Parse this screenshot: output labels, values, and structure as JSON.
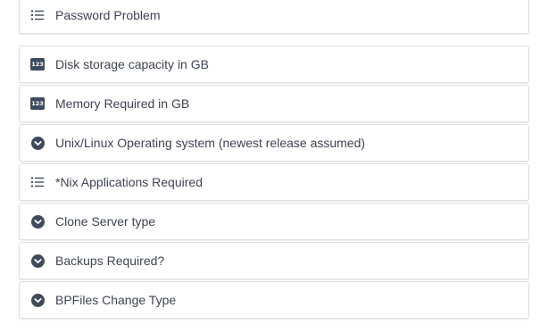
{
  "fields": [
    {
      "icon": "list-icon",
      "label": "Password Problem"
    },
    {
      "icon": "number-icon",
      "label": "Disk storage capacity in GB",
      "badge": "123"
    },
    {
      "icon": "number-icon",
      "label": "Memory Required in GB",
      "badge": "123"
    },
    {
      "icon": "chevron-down-circle-icon",
      "label": "Unix/Linux Operating system (newest release assumed)"
    },
    {
      "icon": "list-icon",
      "label": "*Nix Applications Required"
    },
    {
      "icon": "chevron-down-circle-icon",
      "label": "Clone Server type"
    },
    {
      "icon": "chevron-down-circle-icon",
      "label": "Backups Required?"
    },
    {
      "icon": "chevron-down-circle-icon",
      "label": "BPFiles Change Type"
    }
  ],
  "colors": {
    "icon": "#3f4b5c",
    "text": "#3d4451",
    "border": "#dcdfe4"
  }
}
